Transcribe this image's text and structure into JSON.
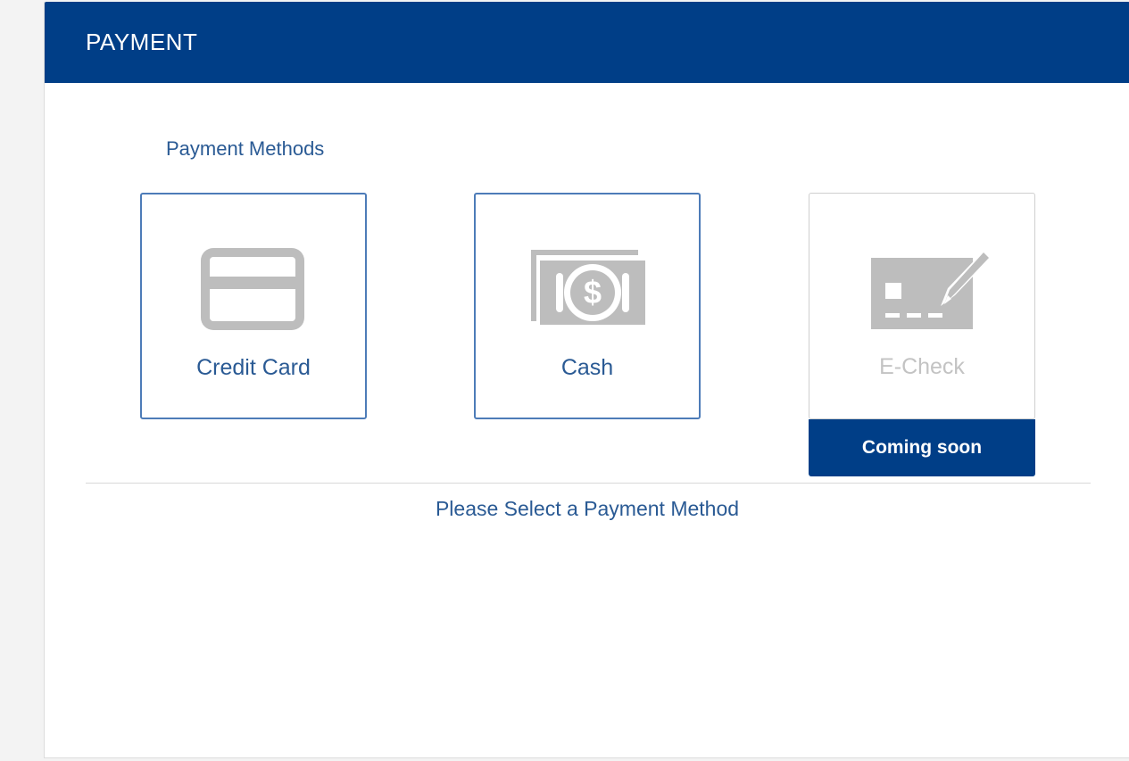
{
  "header": {
    "title": "PAYMENT"
  },
  "payment_methods": {
    "section_label": "Payment Methods",
    "items": [
      {
        "label": "Credit Card",
        "icon": "credit-card-icon",
        "enabled": true
      },
      {
        "label": "Cash",
        "icon": "cash-icon",
        "enabled": true
      },
      {
        "label": "E-Check",
        "icon": "echeck-icon",
        "enabled": false,
        "badge": "Coming soon"
      }
    ]
  },
  "prompt": "Please Select a Payment Method",
  "colors": {
    "header_bg": "#003e87",
    "accent_text": "#2a5a94",
    "card_border": "#4d7cb8",
    "icon_gray": "#bdbdbd",
    "disabled_text": "#c3c3c3"
  }
}
